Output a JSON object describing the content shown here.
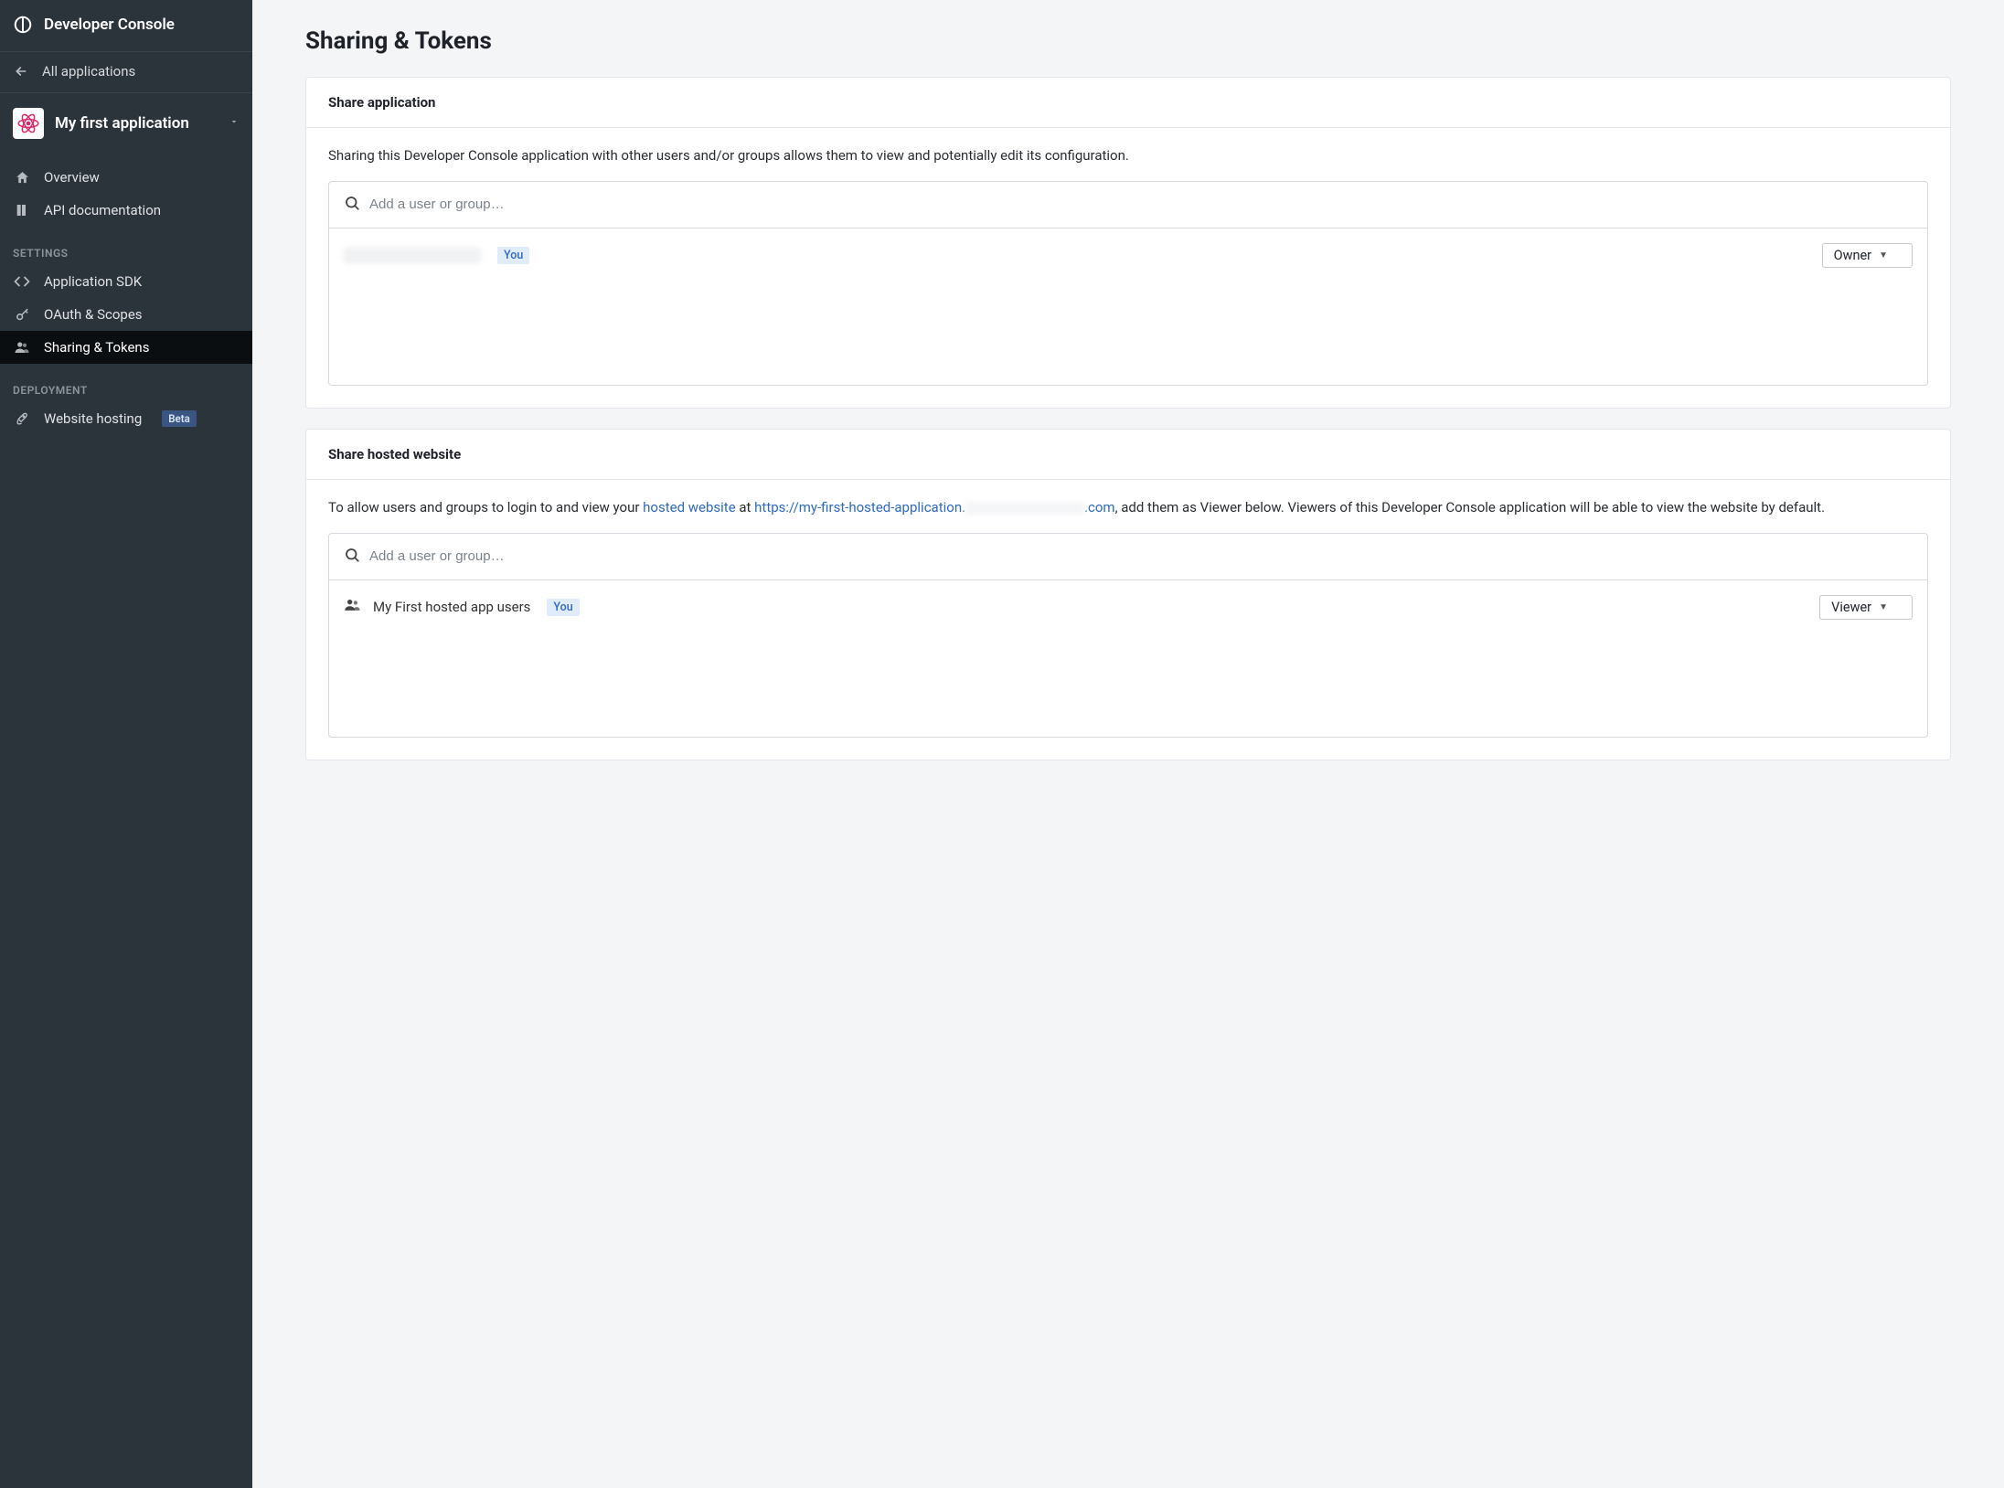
{
  "brand_title": "Developer Console",
  "back_label": "All applications",
  "app_name": "My first application",
  "nav": {
    "overview": "Overview",
    "api_doc": "API documentation",
    "settings_label": "SETTINGS",
    "app_sdk": "Application SDK",
    "oauth": "OAuth & Scopes",
    "sharing": "Sharing & Tokens",
    "deployment_label": "DEPLOYMENT",
    "website_hosting": "Website hosting",
    "beta_badge": "Beta"
  },
  "page_title": "Sharing & Tokens",
  "share_app": {
    "header": "Share application",
    "desc": "Sharing this Developer Console application with other users and/or groups allows them to view and potentially edit its configuration.",
    "placeholder": "Add a user or group…",
    "you_badge": "You",
    "role": "Owner"
  },
  "share_hosted": {
    "header": "Share hosted website",
    "desc_pre": "To allow users and groups to login to and view your ",
    "link_hosted": "hosted website",
    "at_text": " at ",
    "link_url_1": "https://my-first-hosted-application.",
    "link_url_2": ".com",
    "desc_post": ", add them as Viewer below. Viewers of this Developer Console application will be able to view the website by default.",
    "placeholder": "Add a user or group…",
    "group_name": "My First hosted app users",
    "you_badge": "You",
    "role": "Viewer"
  }
}
